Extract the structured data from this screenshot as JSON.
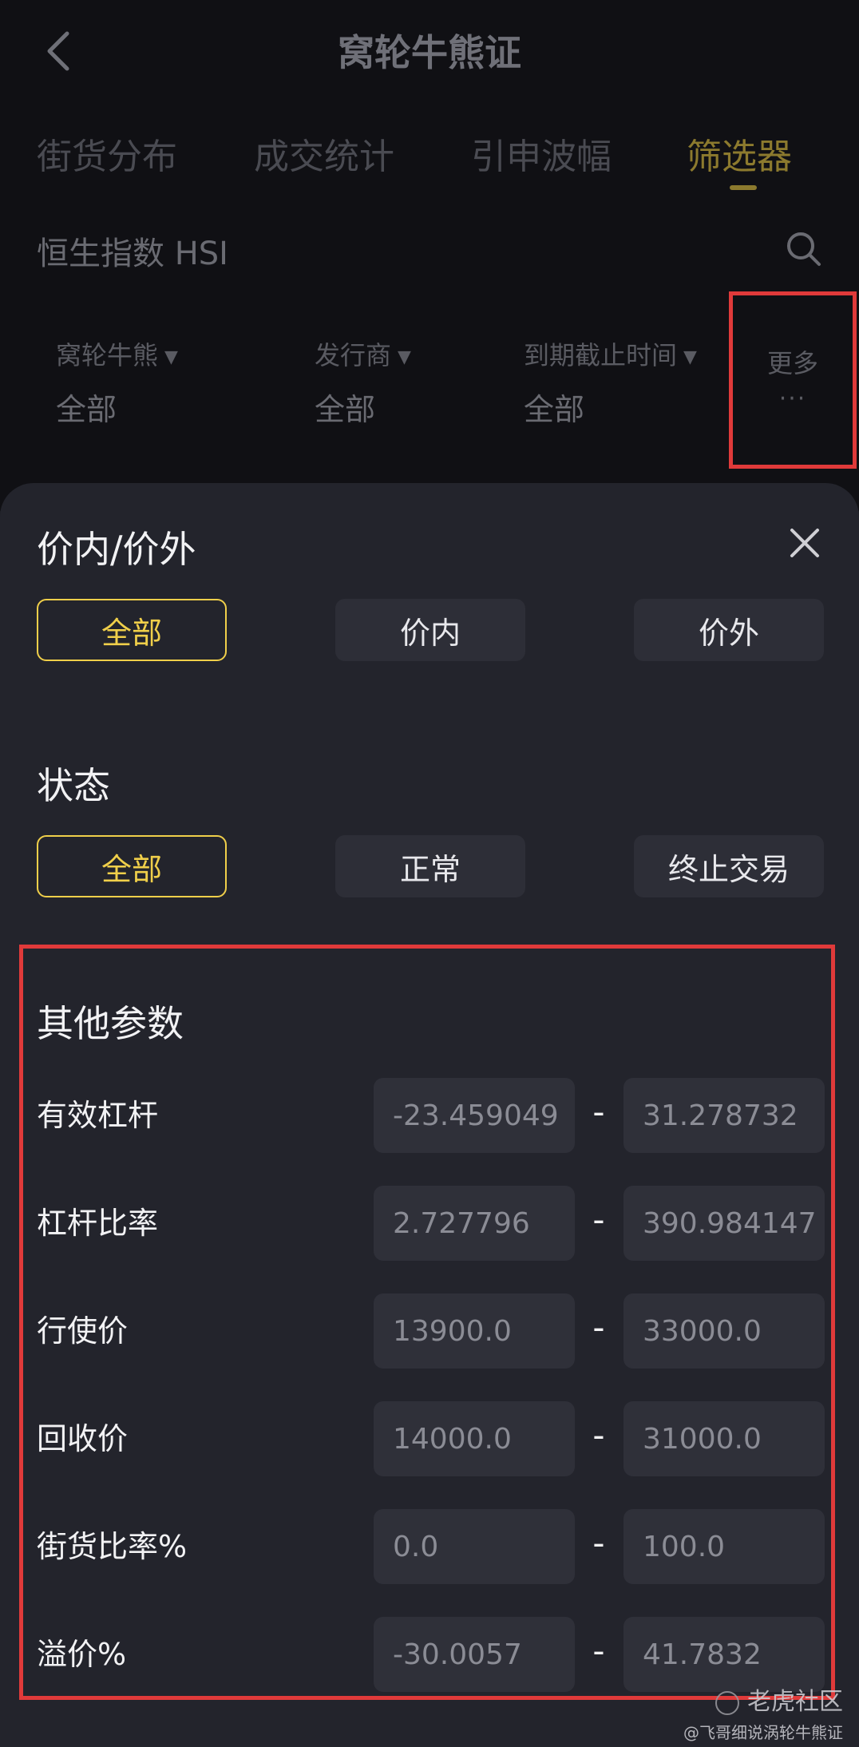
{
  "header": {
    "title": "窝轮牛熊证"
  },
  "tabs": [
    {
      "label": "街货分布"
    },
    {
      "label": "成交统计"
    },
    {
      "label": "引申波幅"
    },
    {
      "label": "筛选器",
      "active": true
    }
  ],
  "search": {
    "text": "恒生指数 HSI"
  },
  "filters": [
    {
      "label": "窝轮牛熊",
      "value": "全部"
    },
    {
      "label": "发行商",
      "value": "全部"
    },
    {
      "label": "到期截止时间",
      "value": "全部"
    }
  ],
  "more": {
    "label": "更多",
    "dots": "···"
  },
  "sheet": {
    "moneyness": {
      "title": "价内/价外",
      "options": [
        "全部",
        "价内",
        "价外"
      ],
      "selected": "全部"
    },
    "status": {
      "title": "状态",
      "options": [
        "全部",
        "正常",
        "终止交易"
      ],
      "selected": "全部"
    },
    "params": {
      "title": "其他参数",
      "rows": [
        {
          "label": "有效杠杆",
          "min": "-23.459049",
          "max": "31.278732"
        },
        {
          "label": "杠杆比率",
          "min": "2.727796",
          "max": "390.984147"
        },
        {
          "label": "行使价",
          "min": "13900.0",
          "max": "33000.0"
        },
        {
          "label": "回收价",
          "min": "14000.0",
          "max": "31000.0"
        },
        {
          "label": "街货比率%",
          "min": "0.0",
          "max": "100.0"
        },
        {
          "label": "溢价%",
          "min": "-30.0057",
          "max": "41.7832"
        }
      ],
      "dash": "-"
    }
  },
  "watermark": {
    "brand": "老虎社区",
    "author": "@飞哥细说涡轮牛熊证"
  },
  "colors": {
    "accent": "#f0cf4a",
    "highlight": "#e03a3a",
    "sheet": "#23242c"
  }
}
